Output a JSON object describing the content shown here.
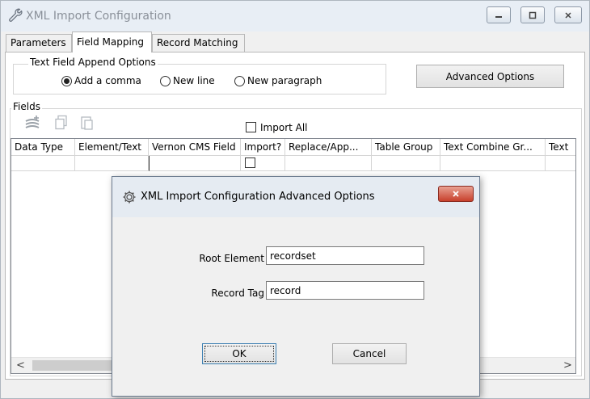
{
  "window": {
    "title": "XML Import Configuration",
    "minimize_glyph": "–",
    "maximize_glyph": "□",
    "close_glyph": "✕"
  },
  "tabs": [
    {
      "label": "Parameters",
      "active": false
    },
    {
      "label": "Field Mapping",
      "active": true
    },
    {
      "label": "Record Matching",
      "active": false
    }
  ],
  "append_options": {
    "group_label": "Text Field Append Options",
    "options": [
      {
        "label": "Add a comma",
        "selected": true
      },
      {
        "label": "New line",
        "selected": false
      },
      {
        "label": "New paragraph",
        "selected": false
      }
    ]
  },
  "advanced_button_label": "Advanced Options",
  "fields": {
    "group_label": "Fields",
    "import_all_label": "Import All",
    "columns": [
      "Data Type",
      "Element/Text",
      "Vernon CMS Field",
      "Import?",
      "Replace/App...",
      "Table Group",
      "Text Combine Gr...",
      "Text"
    ]
  },
  "scrollbar": {
    "left_glyph": "<",
    "right_glyph": ">"
  },
  "dialog": {
    "title": "XML Import Configuration Advanced Options",
    "close_glyph": "✕",
    "root_element_label": "Root Element",
    "root_element_value": "recordset",
    "record_tag_label": "Record Tag",
    "record_tag_value": "record",
    "ok_label": "OK",
    "cancel_label": "Cancel"
  },
  "colors": {
    "title_text": "#8a9099",
    "dialog_close": "#c7402c",
    "panel_bg": "#ffffff",
    "window_bg": "#f0f0f0"
  }
}
